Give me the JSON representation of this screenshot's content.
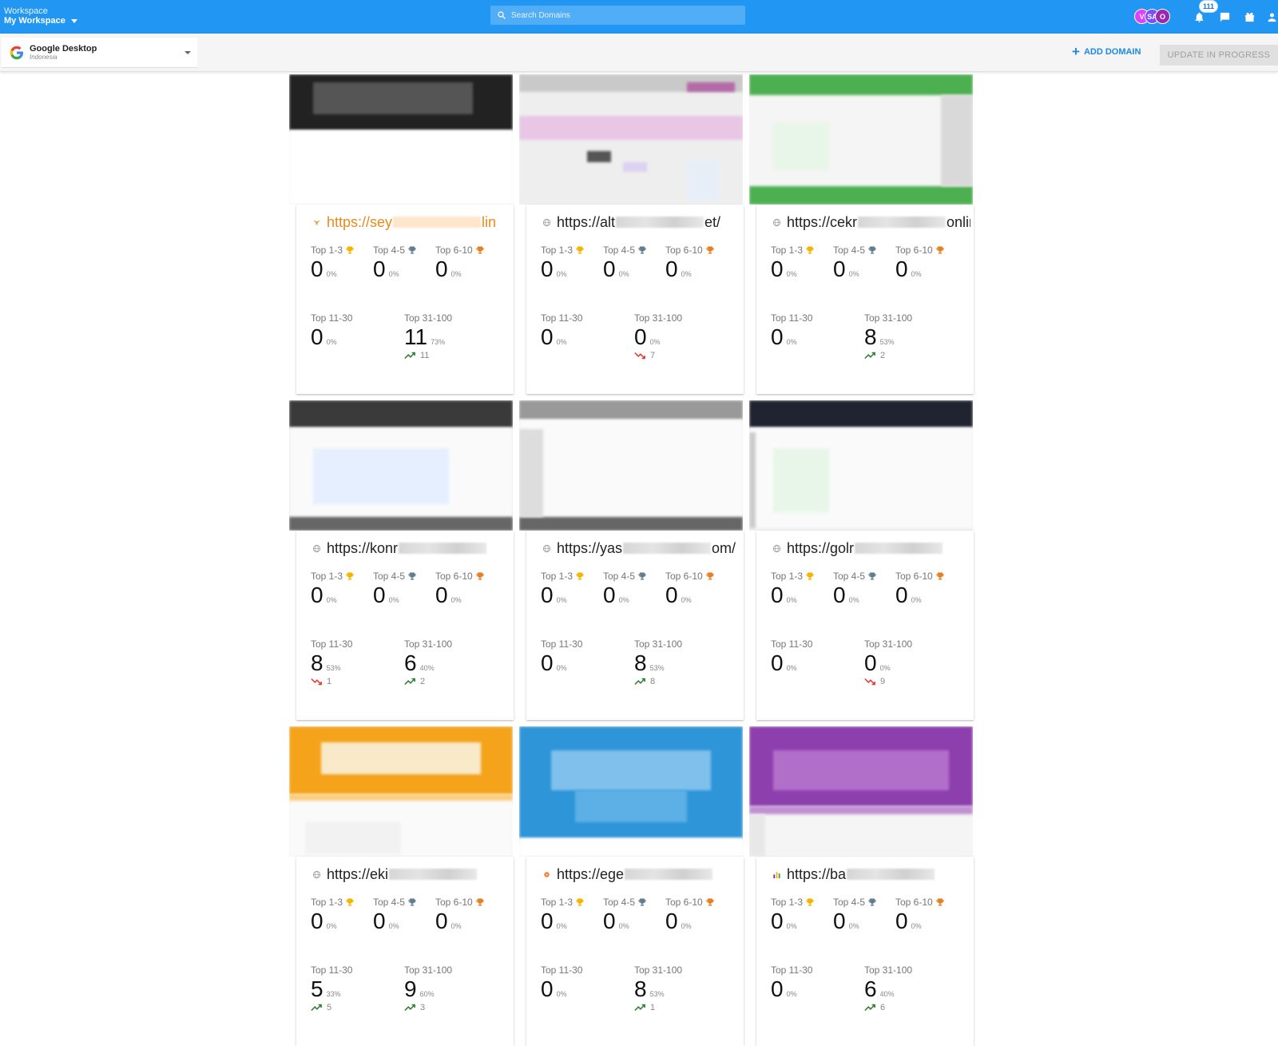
{
  "header": {
    "workspace_label": "Workspace",
    "workspace_name": "My Workspace",
    "search_placeholder": "Search Domains",
    "avatars": [
      "V",
      "SA",
      "O"
    ],
    "notifications_count": "111"
  },
  "subheader": {
    "engine_name": "Google Desktop",
    "engine_location": "Indonesia",
    "add_domain": "ADD DOMAIN",
    "update_status": "UPDATE IN PROGRESS"
  },
  "labels": {
    "top13": "Top 1-3",
    "top45": "Top 4-5",
    "top610": "Top 6-10",
    "top1130": "Top 11-30",
    "top31100": "Top 31-100"
  },
  "colors": {
    "primary": "#2196f3",
    "gold": "#f4b400",
    "silver": "#607d8b",
    "bronze": "#e67e22",
    "trend_up": "#2e7d32",
    "trend_down": "#e53935"
  },
  "cards": [
    {
      "url_start": "https://sey",
      "url_end": "lin",
      "favicon": "orange-bird-icon",
      "t13": {
        "value": "0",
        "pct": "0%"
      },
      "t45": {
        "value": "0",
        "pct": "0%"
      },
      "t610": {
        "value": "0",
        "pct": "0%"
      },
      "t1130": {
        "value": "0",
        "pct": "0%",
        "trend": "",
        "dir": ""
      },
      "t31100": {
        "value": "11",
        "pct": "73%",
        "trend": "11",
        "dir": "up"
      }
    },
    {
      "url_start": "https://alt",
      "url_end": "et/",
      "favicon": "globe-icon",
      "t13": {
        "value": "0",
        "pct": "0%"
      },
      "t45": {
        "value": "0",
        "pct": "0%"
      },
      "t610": {
        "value": "0",
        "pct": "0%"
      },
      "t1130": {
        "value": "0",
        "pct": "0%",
        "trend": "",
        "dir": ""
      },
      "t31100": {
        "value": "0",
        "pct": "0%",
        "trend": "7",
        "dir": "down"
      }
    },
    {
      "url_start": "https://cekr",
      "url_end": "online/",
      "favicon": "globe-icon",
      "t13": {
        "value": "0",
        "pct": "0%"
      },
      "t45": {
        "value": "0",
        "pct": "0%"
      },
      "t610": {
        "value": "0",
        "pct": "0%"
      },
      "t1130": {
        "value": "0",
        "pct": "0%",
        "trend": "",
        "dir": ""
      },
      "t31100": {
        "value": "8",
        "pct": "53%",
        "trend": "2",
        "dir": "up"
      }
    },
    {
      "url_start": "https://konr",
      "url_end": "",
      "favicon": "globe-icon",
      "t13": {
        "value": "0",
        "pct": "0%"
      },
      "t45": {
        "value": "0",
        "pct": "0%"
      },
      "t610": {
        "value": "0",
        "pct": "0%"
      },
      "t1130": {
        "value": "8",
        "pct": "53%",
        "trend": "1",
        "dir": "down"
      },
      "t31100": {
        "value": "6",
        "pct": "40%",
        "trend": "2",
        "dir": "up"
      }
    },
    {
      "url_start": "https://yas",
      "url_end": "om/",
      "favicon": "globe-icon",
      "t13": {
        "value": "0",
        "pct": "0%"
      },
      "t45": {
        "value": "0",
        "pct": "0%"
      },
      "t610": {
        "value": "0",
        "pct": "0%"
      },
      "t1130": {
        "value": "0",
        "pct": "0%",
        "trend": "",
        "dir": ""
      },
      "t31100": {
        "value": "8",
        "pct": "53%",
        "trend": "8",
        "dir": "up"
      }
    },
    {
      "url_start": "https://golr",
      "url_end": "",
      "favicon": "globe-icon",
      "t13": {
        "value": "0",
        "pct": "0%"
      },
      "t45": {
        "value": "0",
        "pct": "0%"
      },
      "t610": {
        "value": "0",
        "pct": "0%"
      },
      "t1130": {
        "value": "0",
        "pct": "0%",
        "trend": "",
        "dir": ""
      },
      "t31100": {
        "value": "0",
        "pct": "0%",
        "trend": "9",
        "dir": "down"
      }
    },
    {
      "url_start": "https://eki",
      "url_end": "",
      "favicon": "globe-icon",
      "t13": {
        "value": "0",
        "pct": "0%"
      },
      "t45": {
        "value": "0",
        "pct": "0%"
      },
      "t610": {
        "value": "0",
        "pct": "0%"
      },
      "t1130": {
        "value": "5",
        "pct": "33%",
        "trend": "5",
        "dir": "up"
      },
      "t31100": {
        "value": "9",
        "pct": "60%",
        "trend": "3",
        "dir": "up"
      }
    },
    {
      "url_start": "https://ege",
      "url_end": "",
      "favicon": "orange-dot-icon",
      "t13": {
        "value": "0",
        "pct": "0%"
      },
      "t45": {
        "value": "0",
        "pct": "0%"
      },
      "t610": {
        "value": "0",
        "pct": "0%"
      },
      "t1130": {
        "value": "0",
        "pct": "0%",
        "trend": "",
        "dir": ""
      },
      "t31100": {
        "value": "8",
        "pct": "53%",
        "trend": "1",
        "dir": "up"
      }
    },
    {
      "url_start": "https://ba",
      "url_end": "",
      "favicon": "bar-chart-icon",
      "t13": {
        "value": "0",
        "pct": "0%"
      },
      "t45": {
        "value": "0",
        "pct": "0%"
      },
      "t610": {
        "value": "0",
        "pct": "0%"
      },
      "t1130": {
        "value": "0",
        "pct": "0%",
        "trend": "",
        "dir": ""
      },
      "t31100": {
        "value": "6",
        "pct": "40%",
        "trend": "6",
        "dir": "up"
      }
    }
  ]
}
